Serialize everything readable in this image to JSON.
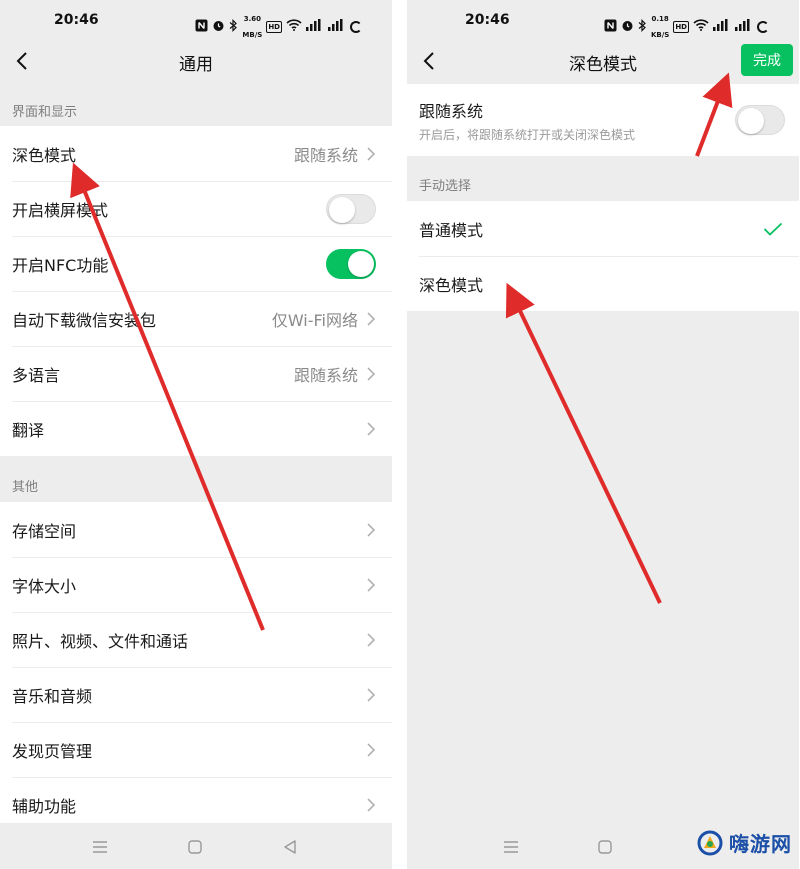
{
  "colors": {
    "accent": "#07c160",
    "arrow": "#e02b2b",
    "bg": "#ededed"
  },
  "left_screen": {
    "status_time": "20:46",
    "net_speed_value": "3.60",
    "net_speed_unit": "MB/S",
    "title": "通用",
    "section1_header": "界面和显示",
    "items1": [
      {
        "label": "深色模式",
        "value": "跟随系统",
        "control": "chevron"
      },
      {
        "label": "开启横屏模式",
        "control": "toggle",
        "state": "off"
      },
      {
        "label": "开启NFC功能",
        "control": "toggle",
        "state": "on"
      },
      {
        "label": "自动下载微信安装包",
        "value": "仅Wi-Fi网络",
        "control": "chevron"
      },
      {
        "label": "多语言",
        "value": "跟随系统",
        "control": "chevron"
      },
      {
        "label": "翻译",
        "control": "chevron"
      }
    ],
    "section2_header": "其他",
    "items2": [
      {
        "label": "存储空间"
      },
      {
        "label": "字体大小"
      },
      {
        "label": "照片、视频、文件和通话"
      },
      {
        "label": "音乐和音频"
      },
      {
        "label": "发现页管理"
      },
      {
        "label": "辅助功能"
      }
    ]
  },
  "right_screen": {
    "status_time": "20:46",
    "net_speed_value": "0.18",
    "net_speed_unit": "KB/S",
    "title": "深色模式",
    "done_label": "完成",
    "follow_system_label": "跟随系统",
    "follow_system_desc": "开启后，将跟随系统打开或关闭深色模式",
    "follow_system_state": "off",
    "manual_header": "手动选择",
    "options": [
      {
        "label": "普通模式",
        "selected": true
      },
      {
        "label": "深色模式",
        "selected": false
      }
    ]
  },
  "watermark": {
    "text": "嗨游网"
  },
  "icons": [
    "back-icon",
    "chevron-right-icon",
    "check-icon",
    "nfc-icon",
    "alarm-icon",
    "bluetooth-icon",
    "wifi-icon",
    "signal-icon",
    "battery-icon",
    "menu-nav-icon",
    "home-nav-icon",
    "back-nav-icon"
  ]
}
